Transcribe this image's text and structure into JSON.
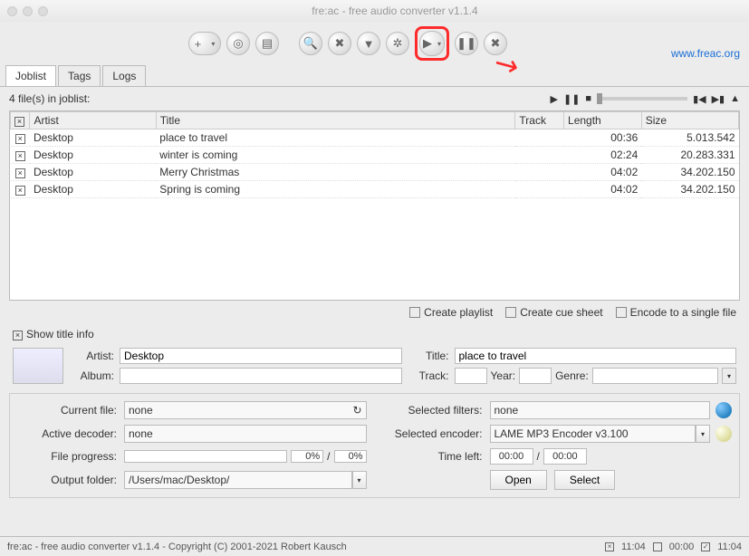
{
  "app": {
    "title": "fre:ac - free audio converter v1.1.4",
    "url": "www.freac.org"
  },
  "tabs": {
    "joblist": "Joblist",
    "tags": "Tags",
    "logs": "Logs"
  },
  "joblist": {
    "count_label": "4 file(s) in joblist:",
    "columns": {
      "artist": "Artist",
      "title": "Title",
      "track": "Track",
      "length": "Length",
      "size": "Size"
    },
    "rows": [
      {
        "artist": "Desktop",
        "title": "place to travel",
        "track": "",
        "length": "00:36",
        "size": "5.013.542"
      },
      {
        "artist": "Desktop",
        "title": "winter is coming",
        "track": "",
        "length": "02:24",
        "size": "20.283.331"
      },
      {
        "artist": "Desktop",
        "title": "Merry Christmas",
        "track": "",
        "length": "04:02",
        "size": "34.202.150"
      },
      {
        "artist": "Desktop",
        "title": "Spring is coming",
        "track": "",
        "length": "04:02",
        "size": "34.202.150"
      }
    ]
  },
  "options": {
    "playlist": "Create playlist",
    "cuesheet": "Create cue sheet",
    "singlefile": "Encode to a single file"
  },
  "titleinfo": {
    "toggle": "Show title info",
    "labels": {
      "artist": "Artist:",
      "title": "Title:",
      "album": "Album:",
      "track": "Track:",
      "year": "Year:",
      "genre": "Genre:"
    },
    "values": {
      "artist": "Desktop",
      "title": "place to travel",
      "album": "",
      "track": "",
      "year": "",
      "genre": ""
    }
  },
  "status": {
    "labels": {
      "current_file": "Current file:",
      "active_decoder": "Active decoder:",
      "file_progress": "File progress:",
      "output_folder": "Output folder:",
      "selected_filters": "Selected filters:",
      "selected_encoder": "Selected encoder:",
      "time_left": "Time left:",
      "open": "Open",
      "select": "Select"
    },
    "values": {
      "current_file": "none",
      "active_decoder": "none",
      "selected_filters": "none",
      "selected_encoder": "LAME MP3 Encoder v3.100",
      "output_folder": "/Users/mac/Desktop/",
      "pct1": "0%",
      "slash": "/",
      "pct2": "0%",
      "time1": "00:00",
      "time2": "00:00"
    }
  },
  "footer": {
    "text": "fre:ac - free audio converter v1.1.4 - Copyright (C) 2001-2021 Robert Kausch",
    "time1": "11:04",
    "time2": "00:00",
    "time3": "11:04"
  }
}
